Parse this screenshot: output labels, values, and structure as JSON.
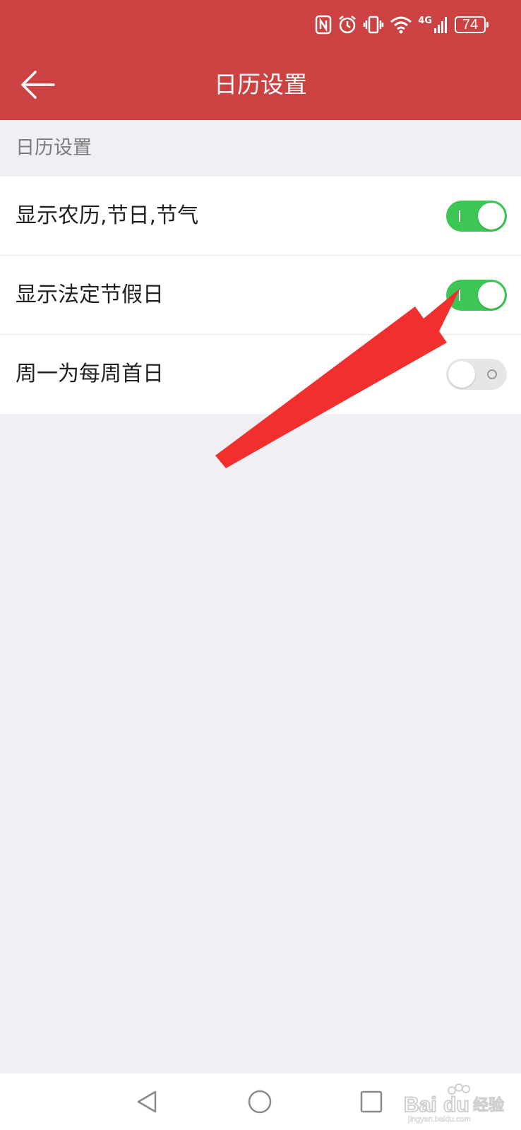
{
  "status_bar": {
    "icons": [
      "nfc-icon",
      "alarm-icon",
      "vibrate-icon",
      "wifi-icon",
      "signal-4g-icon"
    ],
    "network_label": "4G",
    "battery": "74"
  },
  "toolbar": {
    "title": "日历设置",
    "back_icon": "back-arrow-icon"
  },
  "section": {
    "header": "日历设置"
  },
  "settings": [
    {
      "label": "显示农历,节日,节气",
      "enabled": true
    },
    {
      "label": "显示法定节假日",
      "enabled": true
    },
    {
      "label": "周一为每周首日",
      "enabled": false
    }
  ],
  "annotation": {
    "icon": "red-pointer-arrow",
    "color": "#f22f2f"
  },
  "nav_bar": {
    "buttons": [
      "back-triangle-icon",
      "home-circle-icon",
      "recents-square-icon"
    ]
  },
  "watermark": {
    "brand": "Bai du 经验",
    "url": "jingyan.baidu.com"
  },
  "colors": {
    "header": "#cc4141",
    "toggle_on": "#3cc654",
    "toggle_off": "#e6e6e6",
    "background": "#efeff4"
  }
}
